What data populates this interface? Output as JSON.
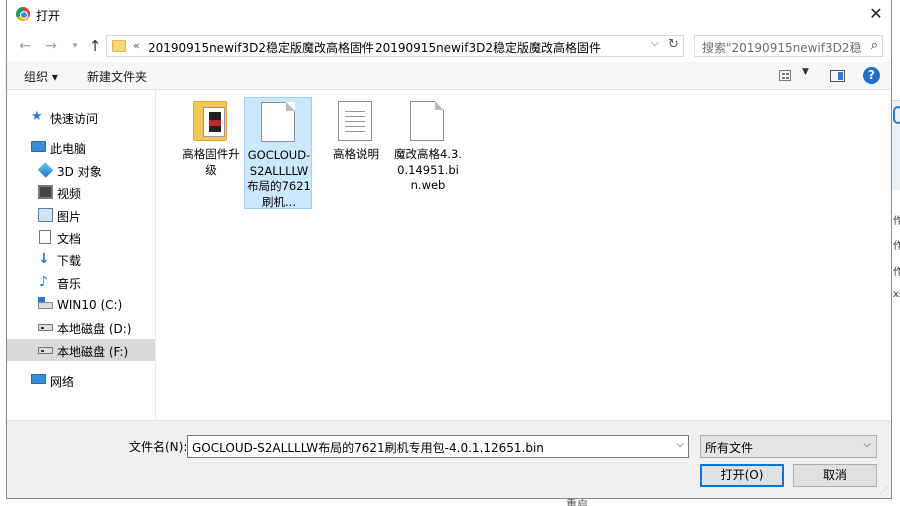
{
  "title": "打开",
  "address": {
    "overflow_label": "«",
    "crumbs": [
      "20190915newif3D2稳定版魔改高格固件",
      "20190915newif3D2稳定版魔改高格固件"
    ],
    "separator": "›"
  },
  "search": {
    "placeholder": "搜索\"20190915newif3D2稳..."
  },
  "toolbar": {
    "organize": "组织 ▾",
    "new_folder": "新建文件夹"
  },
  "sidebar": {
    "items": [
      {
        "label": "快速访问",
        "icon": "star-icon"
      },
      {
        "label": "此电脑",
        "icon": "computer-icon"
      },
      {
        "label": "3D 对象",
        "icon": "3d-objects-icon"
      },
      {
        "label": "视频",
        "icon": "video-icon"
      },
      {
        "label": "图片",
        "icon": "pictures-icon"
      },
      {
        "label": "文档",
        "icon": "documents-icon"
      },
      {
        "label": "下载",
        "icon": "download-icon"
      },
      {
        "label": "音乐",
        "icon": "music-icon"
      },
      {
        "label": "WIN10 (C:)",
        "icon": "windows-drive-icon"
      },
      {
        "label": "本地磁盘 (D:)",
        "icon": "drive-icon"
      },
      {
        "label": "本地磁盘 (F:)",
        "icon": "drive-icon",
        "selected": true
      },
      {
        "label": "网络",
        "icon": "network-icon"
      }
    ]
  },
  "files": [
    {
      "name": "高格固件升级",
      "icon": "folder-icon"
    },
    {
      "name": "GOCLOUD-S2ALLLLW布局的7621刷机...",
      "icon": "file-icon",
      "selected": true
    },
    {
      "name": "高格说明",
      "icon": "text-file-icon"
    },
    {
      "name": "魔改高格4.3.0.14951.bin.web",
      "icon": "file-icon"
    }
  ],
  "bottom": {
    "filename_label": "文件名(N):",
    "filename_value": "GOCLOUD-S2ALLLLW布局的7621刷机专用包-4.0.1.12651.bin",
    "filetype_value": "所有文件",
    "open_label": "打开(O)",
    "cancel_label": "取消"
  },
  "background": {
    "bottom_text": "重启",
    "side_glyphs": [
      "作",
      "作",
      "作",
      "xs"
    ]
  },
  "colors": {
    "accent": "#0078d7",
    "selection": "#cce8ff",
    "sidebar_selected": "#d9d9d9"
  }
}
